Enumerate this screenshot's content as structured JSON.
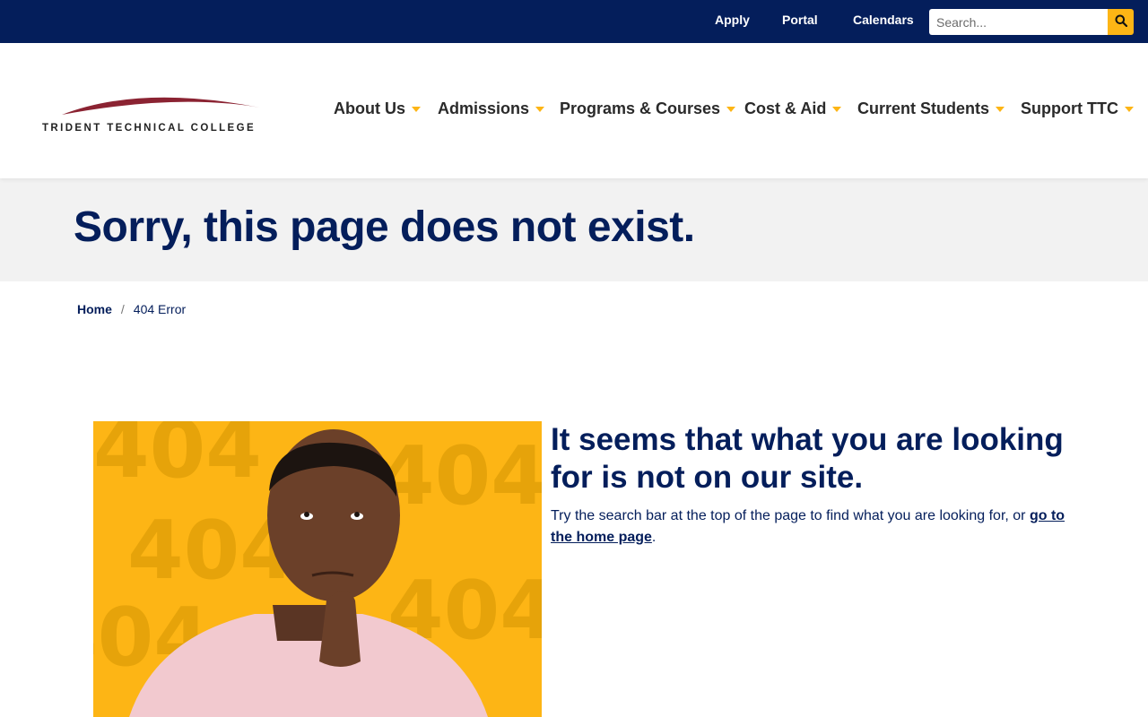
{
  "utility": {
    "links": [
      {
        "label": "Apply"
      },
      {
        "label": "Portal"
      },
      {
        "label": "Calendars"
      }
    ],
    "search_placeholder": "Search..."
  },
  "logo": {
    "text": "TRIDENT TECHNICAL COLLEGE"
  },
  "nav": {
    "items": [
      {
        "label": "About Us"
      },
      {
        "label": "Admissions"
      },
      {
        "label": "Programs & Courses"
      },
      {
        "label": "Cost & Aid"
      },
      {
        "label": "Current Students"
      },
      {
        "label": "Support TTC"
      }
    ]
  },
  "hero": {
    "title": "Sorry, this page does not exist."
  },
  "breadcrumb": {
    "home": "Home",
    "separator": "/",
    "current": "404 Error"
  },
  "illustration": {
    "watermark": "404"
  },
  "content": {
    "heading": "It seems that what you are looking for is not on our site.",
    "body_prefix": "Try the search bar at the top of the page to find what you are looking for, or ",
    "link_label": "go to the home page",
    "body_suffix": "."
  },
  "colors": {
    "navy": "#041e5b",
    "gold": "#fdb515",
    "maroon": "#8b2332",
    "band_gray": "#f2f2f2"
  },
  "icons": {
    "search": "search-icon",
    "nav_caret": "caret-down-icon",
    "logo_arc": "logo-arc-icon"
  }
}
